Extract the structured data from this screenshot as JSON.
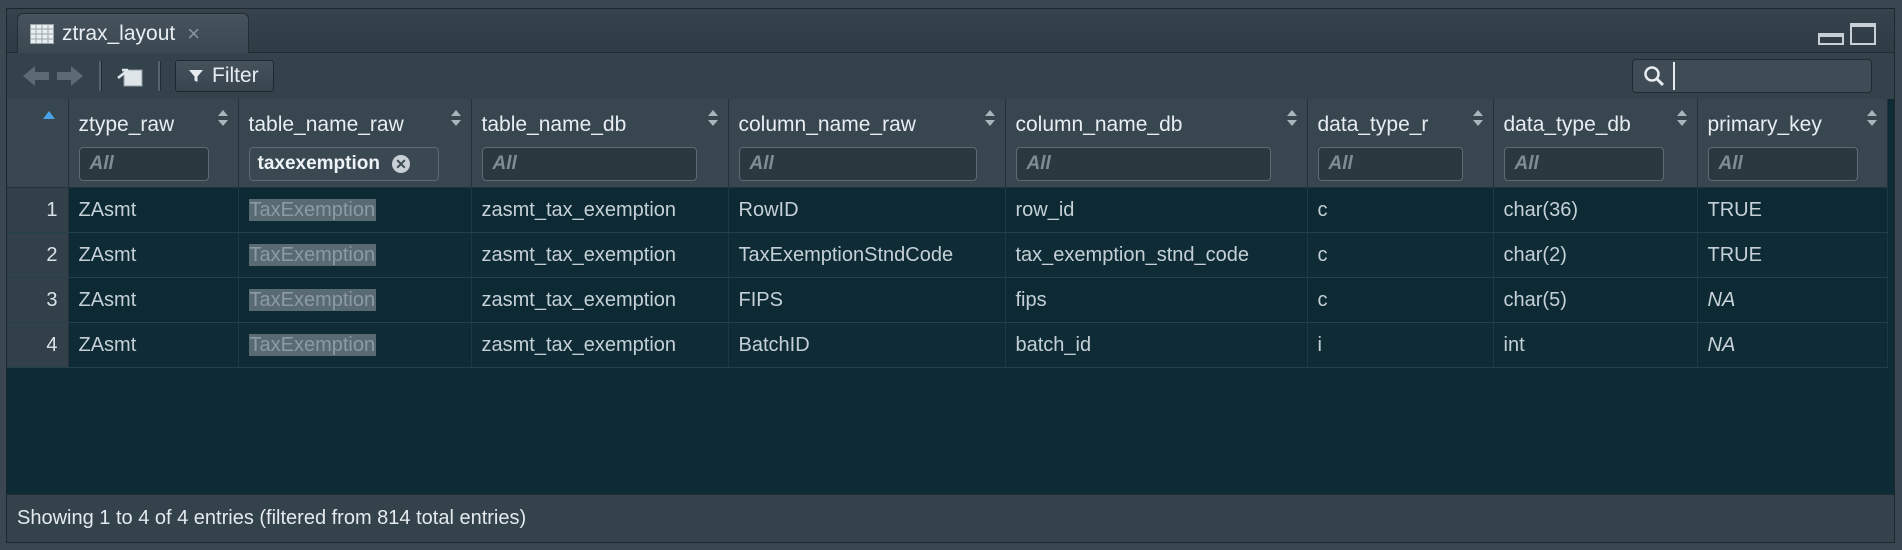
{
  "tab": {
    "title": "ztrax_layout",
    "close": "×"
  },
  "toolbar": {
    "filter_label": "Filter",
    "search_value": ""
  },
  "columns": [
    {
      "label": "",
      "filter": ""
    },
    {
      "label": "ztype_raw",
      "filter": "All"
    },
    {
      "label": "table_name_raw",
      "filter": "taxexemption"
    },
    {
      "label": "table_name_db",
      "filter": "All"
    },
    {
      "label": "column_name_raw",
      "filter": "All"
    },
    {
      "label": "column_name_db",
      "filter": "All"
    },
    {
      "label": "data_type_r",
      "filter": "All"
    },
    {
      "label": "data_type_db",
      "filter": "All"
    },
    {
      "label": "primary_key",
      "filter": "All"
    }
  ],
  "rows": [
    {
      "idx": "1",
      "ztype_raw": "ZAsmt",
      "table_name_raw": "TaxExemption",
      "table_name_db": "zasmt_tax_exemption",
      "column_name_raw": "RowID",
      "column_name_db": "row_id",
      "data_type_r": "c",
      "data_type_db": "char(36)",
      "primary_key": "TRUE"
    },
    {
      "idx": "2",
      "ztype_raw": "ZAsmt",
      "table_name_raw": "TaxExemption",
      "table_name_db": "zasmt_tax_exemption",
      "column_name_raw": "TaxExemptionStndCode",
      "column_name_db": "tax_exemption_stnd_code",
      "data_type_r": "c",
      "data_type_db": "char(2)",
      "primary_key": "TRUE"
    },
    {
      "idx": "3",
      "ztype_raw": "ZAsmt",
      "table_name_raw": "TaxExemption",
      "table_name_db": "zasmt_tax_exemption",
      "column_name_raw": "FIPS",
      "column_name_db": "fips",
      "data_type_r": "c",
      "data_type_db": "char(5)",
      "primary_key": "NA"
    },
    {
      "idx": "4",
      "ztype_raw": "ZAsmt",
      "table_name_raw": "TaxExemption",
      "table_name_db": "zasmt_tax_exemption",
      "column_name_raw": "BatchID",
      "column_name_db": "batch_id",
      "data_type_r": "i",
      "data_type_db": "int",
      "primary_key": "NA"
    }
  ],
  "footer": {
    "status": "Showing 1 to 4 of 4 entries (filtered from 814 total entries)"
  }
}
